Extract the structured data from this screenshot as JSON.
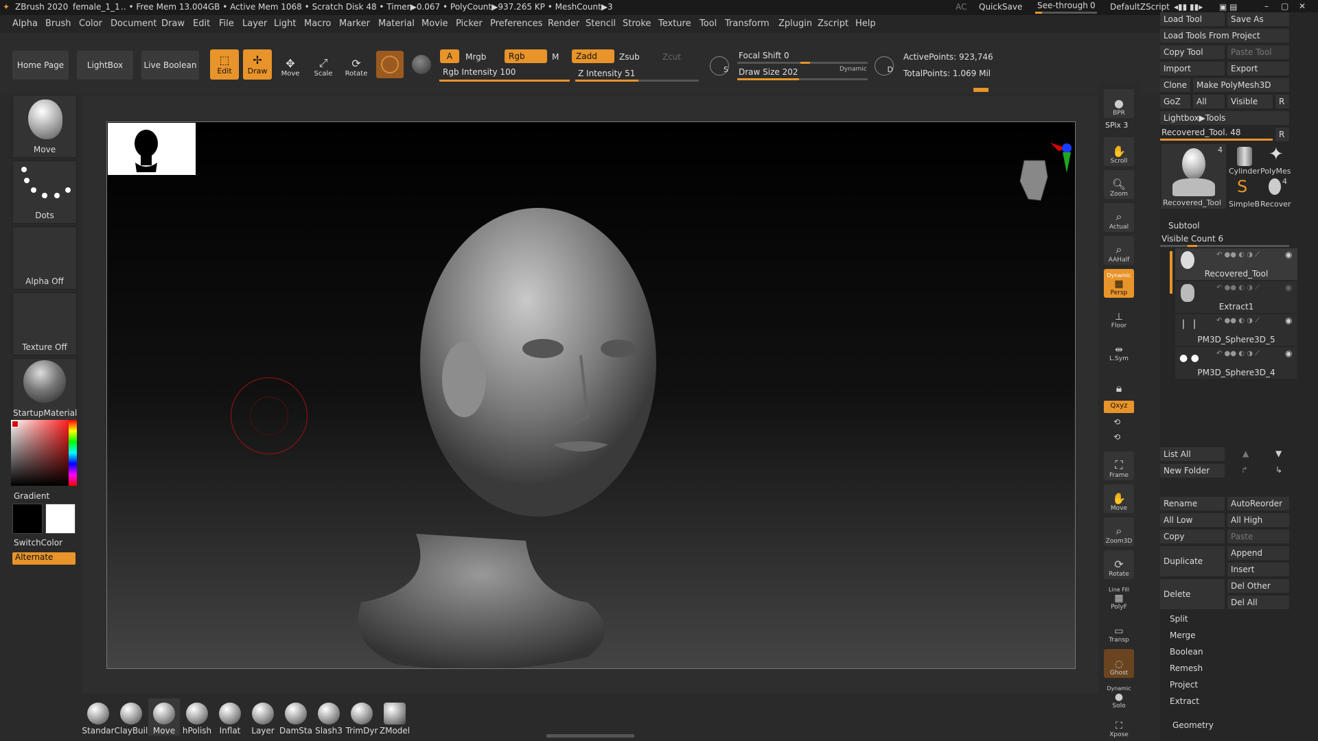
{
  "titlebar": {
    "app": "ZBrush 2020",
    "doc": "female_1_1",
    "stats": ".. • Free Mem 13.004GB • Active Mem 1068 • Scratch Disk 48 • Timer▶0.067 • PolyCount▶937.265 KP  • MeshCount▶3",
    "ac": "AC",
    "quicksave": "QuickSave",
    "seethrough": "See-through",
    "seethrough_val": "0",
    "zscript": "DefaultZScript"
  },
  "menu": [
    "Alpha",
    "Brush",
    "Color",
    "Document",
    "Draw",
    "Edit",
    "File",
    "Layer",
    "Light",
    "Macro",
    "Marker",
    "Material",
    "Movie",
    "Picker",
    "Preferences",
    "Render",
    "Stencil",
    "Stroke",
    "Texture",
    "Tool",
    "Transform",
    "Zplugin",
    "Zscript",
    "Help"
  ],
  "shelf": {
    "home": "Home Page",
    "lightbox": "LightBox",
    "liveboolean": "Live Boolean",
    "edit": "Edit",
    "draw": "Draw",
    "move": "Move",
    "scale": "Scale",
    "rotate": "Rotate",
    "a": "A",
    "mrgb": "Mrgb",
    "rgb": "Rgb",
    "m": "M",
    "zadd": "Zadd",
    "zsub": "Zsub",
    "zcut": "Zcut",
    "rgb_intensity": "Rgb Intensity 100",
    "z_intensity": "Z Intensity 51",
    "focal_shift": "Focal Shift 0",
    "draw_size": "Draw Size 202",
    "dynamic": "Dynamic",
    "active_points": "ActivePoints: 923,746",
    "total_points": "TotalPoints: 1.069 Mil",
    "s": "S",
    "d": "D"
  },
  "left": {
    "brush": "Move",
    "stroke": "Dots",
    "alpha": "Alpha Off",
    "texture": "Texture Off",
    "material": "StartupMaterial",
    "gradient": "Gradient",
    "switchcolor": "SwitchColor",
    "alternate": "Alternate"
  },
  "rightstrip": [
    "BPR",
    "SPix 3",
    "Scroll",
    "Zoom",
    "Actual",
    "AAHalf",
    "Persp",
    "Floor",
    "L.Sym",
    "",
    "Qxyz",
    "",
    "",
    "Frame",
    "Move",
    "Zoom3D",
    "Rotate",
    "PolyF",
    "Transp",
    "Ghost",
    "Solo",
    "Xpose"
  ],
  "rightstrip_extra": {
    "dynamic": "Dynamic",
    "linefill": "Line Fill"
  },
  "tool": {
    "load": "Load Tool",
    "saveas": "Save As",
    "loadproject": "Load Tools From Project",
    "copy": "Copy Tool",
    "paste": "Paste Tool",
    "import": "Import",
    "export": "Export",
    "clone": "Clone",
    "makepm": "Make PolyMesh3D",
    "goz": "GoZ",
    "all": "All",
    "visible": "Visible",
    "r": "R",
    "lightbox_tools": "Lightbox▶Tools",
    "current": "Recovered_Tool. 48",
    "thumbs": [
      "Recovered_Tool",
      "Cylinder",
      "PolyMes",
      "SimpleB",
      "Recover"
    ],
    "thumb_count_a": "4",
    "thumb_count_b": "4"
  },
  "subtool": {
    "title": "Subtool",
    "visible_count": "Visible Count 6",
    "items": [
      "Recovered_Tool",
      "Extract1",
      "PM3D_Sphere3D_5",
      "PM3D_Sphere3D_4"
    ],
    "listall": "List All",
    "newfolder": "New Folder",
    "rename": "Rename",
    "autoreorder": "AutoReorder",
    "alllow": "All Low",
    "allhigh": "All High",
    "copy": "Copy",
    "paste": "Paste",
    "duplicate": "Duplicate",
    "append": "Append",
    "insert": "Insert",
    "delete": "Delete",
    "delother": "Del Other",
    "delall": "Del All",
    "split": "Split",
    "merge": "Merge",
    "boolean": "Boolean",
    "remesh": "Remesh",
    "project": "Project",
    "extract": "Extract",
    "geometry": "Geometry"
  },
  "bottom": [
    "Standar",
    "ClayBuil",
    "Move",
    "hPolish",
    "Inflat",
    "Layer",
    "DamSta",
    "Slash3",
    "TrimDyr",
    "ZModel"
  ],
  "colors": {
    "accent": "#e8942a",
    "bg": "#2a2a2a"
  }
}
